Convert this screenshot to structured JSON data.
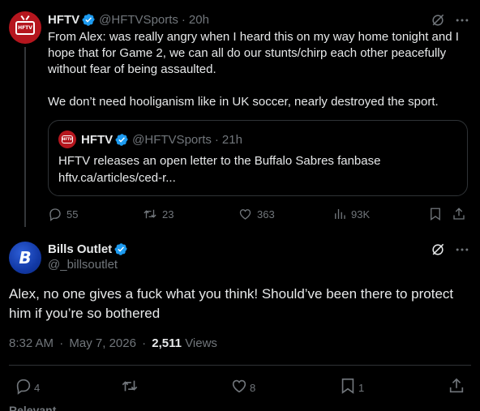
{
  "parent_tweet": {
    "avatar_text": "HFTV",
    "display_name": "HFTV",
    "handle": "@HFTVSports",
    "separator": "·",
    "time": "20h",
    "text_paragraphs": [
      "From Alex: was really angry when I heard this on my way home tonight and I hope that for Game 2, we can all do our stunts/chirp each other peacefully without fear of being assaulted.",
      "We don’t need hooliganism like in UK soccer, nearly destroyed the sport."
    ],
    "quote": {
      "avatar_text": "HFTV",
      "display_name": "HFTV",
      "handle": "@HFTVSports",
      "separator": "·",
      "time": "21h",
      "text_line1": "HFTV releases an open letter to the Buffalo Sabres fanbase",
      "text_line2": "hftv.ca/articles/ced-r..."
    },
    "stats": {
      "replies": "55",
      "reposts": "23",
      "likes": "363",
      "views": "93K"
    }
  },
  "main_tweet": {
    "avatar_letter": "B",
    "display_name": "Bills Outlet",
    "handle": "@_billsoutlet",
    "text": "Alex, no one gives a fuck what you think! Should’ve been there to protect him if you’re so bothered",
    "time": "8:32 AM",
    "separator": "·",
    "date": "May 7, 2026",
    "separator2": "·",
    "views_count": "2,511",
    "views_label": "Views",
    "stats": {
      "replies": "4",
      "reposts": "",
      "likes": "8",
      "bookmarks": "1"
    }
  },
  "section_label": "Relevant",
  "colors": {
    "background": "#000000",
    "text": "#e7e9ea",
    "muted": "#71767b",
    "verified": "#1d9bf0",
    "border": "#2f3336",
    "hftv_red": "#b5161e",
    "bills_blue": "#1239a6"
  },
  "icons": [
    "verified-badge-icon",
    "grok-icon",
    "more-icon",
    "reply-icon",
    "repost-icon",
    "like-icon",
    "views-icon",
    "bookmark-icon",
    "share-icon"
  ]
}
